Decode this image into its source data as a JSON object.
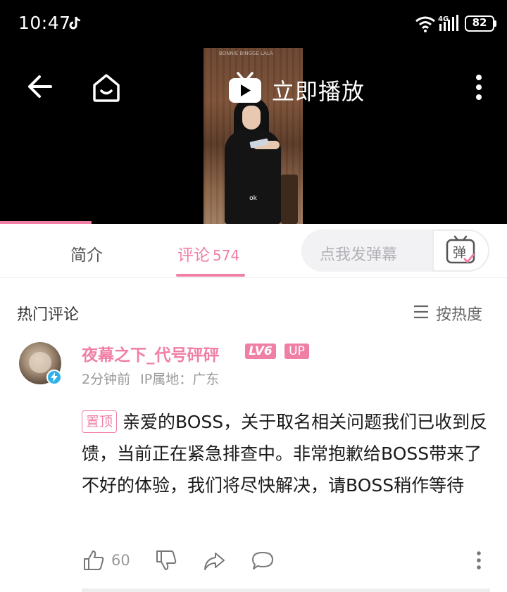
{
  "status_bar": {
    "time": "10:47",
    "battery": "82",
    "network": "4G"
  },
  "player": {
    "play_label": "立即播放",
    "video": {
      "brand_text": "BONNIE BINGGE LALA",
      "subtitle": "ok"
    },
    "progress_percent": 18
  },
  "tabs": {
    "intro_label": "简介",
    "comments_label": "评论",
    "comments_count": "574",
    "danmu_placeholder": "点我发弹幕",
    "danmu_icon_char": "弹"
  },
  "comments": {
    "section_title": "热门评论",
    "sort_label": "按热度",
    "items": [
      {
        "username": "夜幕之下_代号砰砰",
        "level": "LV6",
        "up_badge": "UP",
        "time": "2分钟前",
        "ip": "IP属地：广东",
        "pin_label": "置顶",
        "text": "亲爱的BOSS，关于取名相关问题我们已收到反馈，当前正在紧急排查中。非常抱歉给BOSS带来了不好的体验，我们将尽快解决，请BOSS稍作等待",
        "likes": "60"
      }
    ]
  },
  "colors": {
    "accent": "#f07fa5",
    "badge_blue": "#2fb1e8"
  },
  "icons": [
    "tiktok-icon",
    "wifi-icon",
    "signal-icon",
    "battery-icon",
    "back-icon",
    "home-icon",
    "tv-play-icon",
    "more-icon",
    "danmu-icon",
    "sort-icon",
    "like-icon",
    "dislike-icon",
    "share-icon",
    "reply-icon"
  ]
}
